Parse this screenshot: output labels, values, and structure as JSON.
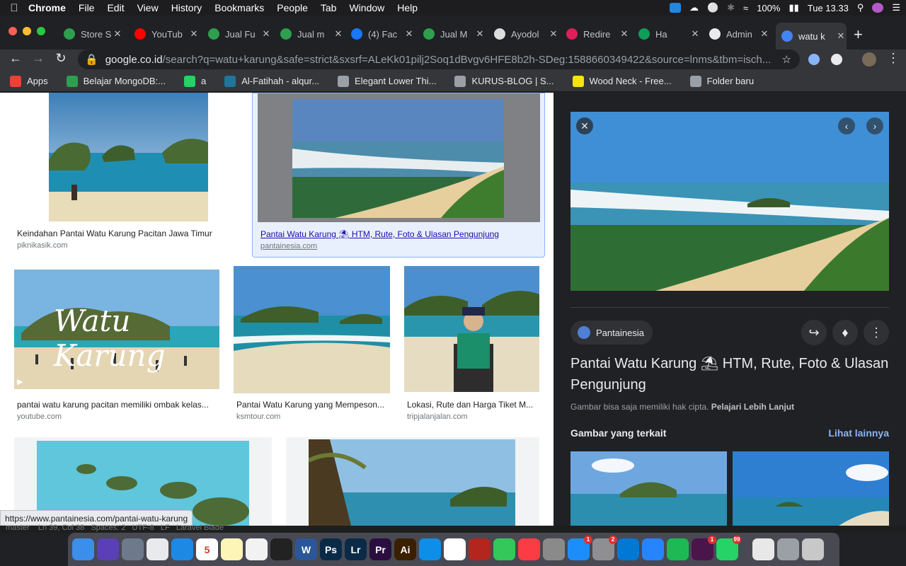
{
  "menubar": {
    "app": "Chrome",
    "items": [
      "File",
      "Edit",
      "View",
      "History",
      "Bookmarks",
      "People",
      "Tab",
      "Window",
      "Help"
    ],
    "battery": "100%",
    "clock": "Tue 13.33"
  },
  "tabs": [
    {
      "title": "Store S",
      "color": "#2e9e4f"
    },
    {
      "title": "YouTub",
      "color": "#ff0000"
    },
    {
      "title": "Jual Fu",
      "color": "#2e9e4f"
    },
    {
      "title": "Jual m",
      "color": "#2e9e4f"
    },
    {
      "title": "(4) Fac",
      "color": "#1877f2"
    },
    {
      "title": "Jual M",
      "color": "#2e9e4f"
    },
    {
      "title": "Ayodol",
      "color": "#dddddd"
    },
    {
      "title": "Redire",
      "color": "#e01e5a"
    },
    {
      "title": "Ha",
      "color": "#0f9d58"
    },
    {
      "title": "Admin",
      "color": "#e8eaed"
    },
    {
      "title": "watu k",
      "color": "#4285f4"
    }
  ],
  "address": {
    "host": "google.co.id",
    "path": "/search?q=watu+karung&safe=strict&sxsrf=ALeKk01pilj2Soq1dBvgv6HFE8b2h-SDeg:1588660349422&source=lnms&tbm=isch..."
  },
  "bookmarks": [
    {
      "label": "Apps",
      "color": "#ea4335"
    },
    {
      "label": "Belajar MongoDB:...",
      "color": "#2e9e4f"
    },
    {
      "label": "a",
      "color": "#25d366"
    },
    {
      "label": "Al-Fatihah - alqur...",
      "color": "#21759b"
    },
    {
      "label": "Elegant Lower Thi...",
      "color": "#9aa0a6"
    },
    {
      "label": "KURUS-BLOG | S...",
      "color": "#9aa0a6"
    },
    {
      "label": "Wood Neck - Free...",
      "color": "#f5e50a"
    },
    {
      "label": "Folder baru",
      "color": "#9aa0a6"
    }
  ],
  "results": [
    {
      "caption": "Keindahan Pantai Watu Karung Pacitan Jawa Timur",
      "source": "piknikasik.com"
    },
    {
      "caption": "Pantai Watu Karung ⛱ HTM, Rute, Foto & Ulasan Pengunjung",
      "source": "pantainesia.com"
    },
    {
      "caption": "pantai watu karung pacitan memiliki ombak kelas...",
      "source": "youtube.com",
      "overlay": "Watu Karung"
    },
    {
      "caption": "Pantai Watu Karung yang Mempeson...",
      "source": "ksmtour.com"
    },
    {
      "caption": "Lokasi, Rute dan Harga Tiket M...",
      "source": "tripjalanjalan.com"
    }
  ],
  "panel": {
    "source_name": "Pantainesia",
    "title": "Pantai Watu Karung ⛱ HTM, Rute, Foto & Ulasan Pengunjung",
    "copyright": "Gambar bisa saja memiliki hak cipta.",
    "learn_more": "Pelajari Lebih Lanjut",
    "related_heading": "Gambar yang terkait",
    "see_more": "Lihat lainnya"
  },
  "status_url": "https://www.pantainesia.com/pantai-watu-karung",
  "editor_status": "master    Ln 39, Col 38   Spaces: 2   UTF-8   LF   Laravel Blade",
  "dock": [
    {
      "name": "finder",
      "color": "#3b8eea",
      "badge": ""
    },
    {
      "name": "siri",
      "color": "#5b3fb6",
      "badge": ""
    },
    {
      "name": "launchpad",
      "color": "#6d7a8c",
      "badge": ""
    },
    {
      "name": "chrome",
      "color": "#e8eaed",
      "badge": ""
    },
    {
      "name": "safari",
      "color": "#1e88e5",
      "badge": ""
    },
    {
      "name": "calendar",
      "color": "#ffffff",
      "badge": "",
      "text": "5"
    },
    {
      "name": "notes",
      "color": "#fdf5b8",
      "badge": ""
    },
    {
      "name": "textedit",
      "color": "#f2f2f2",
      "badge": ""
    },
    {
      "name": "terminal",
      "color": "#222222",
      "badge": ""
    },
    {
      "name": "word",
      "color": "#2b579a",
      "badge": "",
      "text": "W"
    },
    {
      "name": "photoshop",
      "color": "#0a2a47",
      "badge": "",
      "text": "Ps"
    },
    {
      "name": "lightroom",
      "color": "#0a2a47",
      "badge": "",
      "text": "Lr"
    },
    {
      "name": "premiere",
      "color": "#2a0e3f",
      "badge": "",
      "text": "Pr"
    },
    {
      "name": "illustrator",
      "color": "#3a1f00",
      "badge": "",
      "text": "Ai"
    },
    {
      "name": "teamviewer",
      "color": "#0e8ee9",
      "badge": ""
    },
    {
      "name": "photos",
      "color": "#ffffff",
      "badge": ""
    },
    {
      "name": "photo-booth",
      "color": "#b3261e",
      "badge": ""
    },
    {
      "name": "facetime",
      "color": "#34c759",
      "badge": ""
    },
    {
      "name": "music",
      "color": "#fc3c44",
      "badge": ""
    },
    {
      "name": "preview",
      "color": "#8a8a8a",
      "badge": ""
    },
    {
      "name": "app-store",
      "color": "#1c8ef9",
      "badge": "1"
    },
    {
      "name": "system-preferences",
      "color": "#8e8e93",
      "badge": "2"
    },
    {
      "name": "vscode",
      "color": "#0078d4",
      "badge": ""
    },
    {
      "name": "sourcetree",
      "color": "#2684ff",
      "badge": ""
    },
    {
      "name": "spotify",
      "color": "#1db954",
      "badge": ""
    },
    {
      "name": "slack",
      "color": "#4a154b",
      "badge": "1"
    },
    {
      "name": "whatsapp",
      "color": "#25d366",
      "badge": "99"
    },
    {
      "name": "documents",
      "color": "#e8e8e8",
      "badge": ""
    },
    {
      "name": "downloads",
      "color": "#9aa0a6",
      "badge": ""
    },
    {
      "name": "trash",
      "color": "#c8c8c8",
      "badge": ""
    }
  ]
}
